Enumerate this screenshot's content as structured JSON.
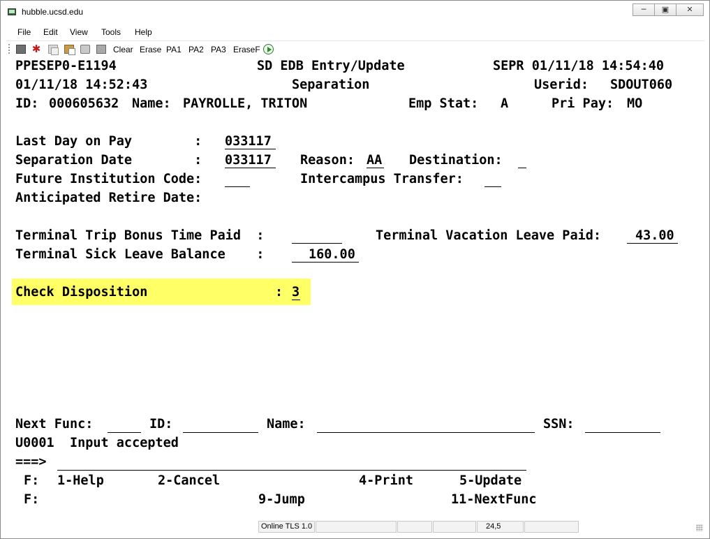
{
  "window": {
    "title": "hubble.ucsd.edu",
    "controls": [
      "minimize-icon",
      "restore-icon",
      "close-icon"
    ]
  },
  "menu": [
    "File",
    "Edit",
    "View",
    "Tools",
    "Help"
  ],
  "toolbar": {
    "icons": [
      "disk-icon",
      "maple-leaf-icon",
      "copy-icon",
      "paste-icon",
      "print-icon",
      "properties-icon",
      "run-icon"
    ],
    "buttons": [
      "Clear",
      "Erase",
      "PA1",
      "PA2",
      "PA3",
      "EraseF"
    ]
  },
  "terminal": {
    "line1_left": "PPESEP0-E1194",
    "line1_center": "SD EDB Entry/Update",
    "line1_right": "SEPR 01/11/18 14:54:40",
    "line2_left": "01/11/18 14:52:43",
    "line2_center": "Separation",
    "userid_label": "Userid:",
    "userid_value": "SDOUT060",
    "id_label": "ID:",
    "id_value": "000605632",
    "name_label": "Name:",
    "name_value": "PAYROLLE, TRITON",
    "emp_stat_label": "Emp Stat:",
    "emp_stat_value": "A",
    "pri_pay_label": "Pri Pay:",
    "pri_pay_value": "MO",
    "last_day_label": "Last Day on Pay        :",
    "last_day_value": "033117",
    "sep_date_label": "Separation Date        :",
    "sep_date_value": "033117",
    "reason_label": "Reason:",
    "reason_value": "AA",
    "destination_label": "Destination:",
    "destination_value": "",
    "future_inst_label": "Future Institution Code:",
    "future_inst_value": "",
    "intercampus_label": "Intercampus Transfer:",
    "intercampus_value": "",
    "retire_label": "Anticipated Retire Date:",
    "trip_bonus_label": "Terminal Trip Bonus Time Paid  :",
    "trip_bonus_value": "",
    "vac_leave_label": "Terminal Vacation Leave Paid:",
    "vac_leave_value": "43.00",
    "sick_leave_label": "Terminal Sick Leave Balance    :",
    "sick_leave_value": "160.00",
    "check_disp_label": "Check Disposition",
    "check_disp_colon": ":",
    "check_disp_value": "3",
    "next_func_label": "Next Func:",
    "next_id_label": "ID:",
    "next_name_label": "Name:",
    "next_ssn_label": "SSN:",
    "message": "U0001  Input accepted",
    "prompt": "===>",
    "fkeys_1_label": "F:",
    "fkeys_1": [
      "1-Help",
      "2-Cancel",
      "4-Print",
      "5-Update"
    ],
    "fkeys_2_label": "F:",
    "fkeys_2": [
      "9-Jump",
      "11-NextFunc"
    ],
    "highlight_color": "#ffff66"
  },
  "statusbar": {
    "connection": "Online TLS 1.0",
    "cursor": "24,5"
  }
}
